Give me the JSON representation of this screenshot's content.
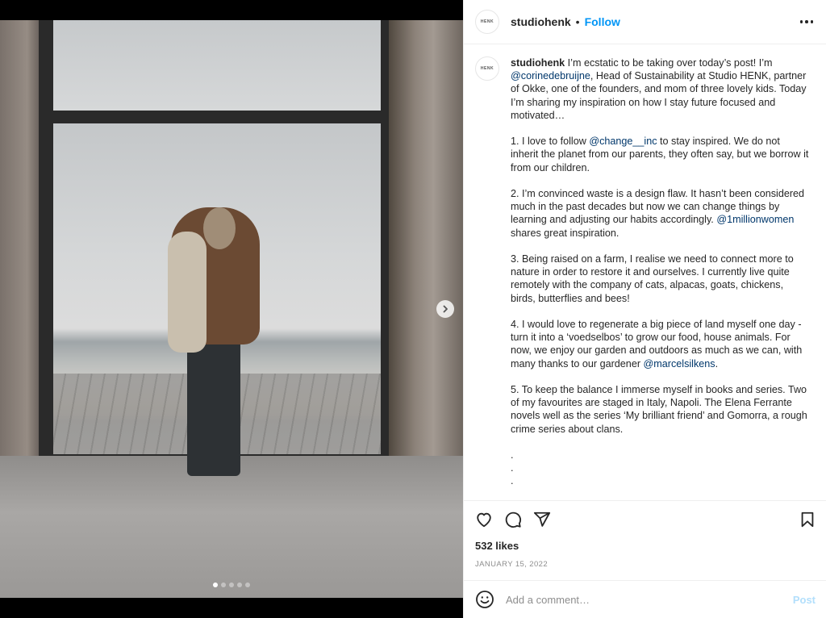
{
  "post": {
    "username": "studiohenk",
    "avatar_text": "HENK",
    "separator": "•",
    "follow_label": "Follow",
    "more_options_icon": "more-horizontal-icon"
  },
  "media": {
    "description": "Woman holding a child standing before a large window overlooking the sea and a wooden deck",
    "carousel": {
      "total": 5,
      "active_index": 0
    },
    "next_icon": "chevron-right-icon"
  },
  "caption": {
    "username": "studiohenk",
    "intro_pre": " I’m ecstatic to be taking over today’s post! I’m ",
    "intro_mention": "@corinedebruijne",
    "intro_post": ", Head of Sustainability at Studio HENK, partner of Okke, one of the founders, and mom of three lovely kids. Today I’m sharing my inspiration on how I stay future focused and motivated…",
    "p1_pre": "1. I love to follow ",
    "p1_mention": "@change__inc",
    "p1_post": " to stay inspired. We do not inherit the planet from our parents, they often say, but we borrow it from our children.",
    "p2_pre": "2. I’m convinced waste is a design flaw. It hasn’t been considered much in the past decades but now we can change things by learning and adjusting our habits accordingly. ",
    "p2_mention": "@1millionwomen",
    "p2_post": " shares great inspiration.",
    "p3": "3. Being raised on a farm, I realise we need to connect more to nature in order to restore it and ourselves. I currently live quite remotely with the company of cats, alpacas, goats, chickens, birds, butterflies and bees!",
    "p4_pre": "4. I would love to regenerate a big piece of land myself one day - turn it into a ‘voedselbos’ to grow our food, house animals. For now, we enjoy our garden and outdoors as much as we can, with many thanks to our gardener ",
    "p4_mention": "@marcelsilkens",
    "p4_post": ".",
    "p5": "5. To keep the balance I immerse myself in books and series. Two of my favourites are staged in Italy, Napoli. The Elena Ferrante novels well as the series ‘My brilliant friend’ and Gomorra, a rough crime series about clans.",
    "dots": [
      ".",
      ".",
      "."
    ]
  },
  "actions": {
    "like_icon": "heart-icon",
    "comment_icon": "comment-icon",
    "share_icon": "send-icon",
    "save_icon": "bookmark-icon",
    "likes": "532 likes",
    "date": "JANUARY 15, 2022"
  },
  "comment_box": {
    "emoji_icon": "emoji-icon",
    "placeholder": "Add a comment…",
    "value": "",
    "post_label": "Post"
  },
  "colors": {
    "accent": "#0095f6",
    "mention": "#00376b",
    "post_disabled": "#b2dffc",
    "secondary_text": "#8e8e8e"
  }
}
